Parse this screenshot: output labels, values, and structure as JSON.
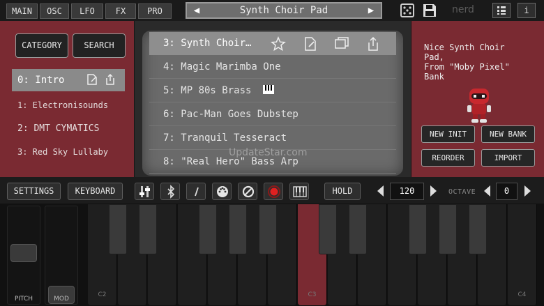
{
  "top_tabs": [
    "MAIN",
    "OSC",
    "LFO",
    "FX",
    "PRO"
  ],
  "preset": {
    "name": "Synth Choir Pad"
  },
  "brand": "nerd",
  "top_icons": [
    "dice-icon",
    "save-icon",
    "grid-icon",
    "info-icon"
  ],
  "info_label": "i",
  "left": {
    "category_label": "CATEGORY",
    "search_label": "SEARCH",
    "items": [
      "0: Intro",
      "1: Electronisounds",
      "2: DMT CYMATICS",
      "3: Red Sky Lullaby"
    ]
  },
  "presets": [
    "3: Synth Choir…",
    "4: Magic Marimba One",
    "5: MP 80s Brass",
    "6: Pac-Man Goes Dubstep",
    "7: Tranquil Tesseract",
    "8: \"Real Hero\" Bass Arp"
  ],
  "watermark": "UpdateStar.com",
  "right": {
    "description": [
      "Nice Synth Choir",
      "Pad,",
      "From \"Moby Pixel\"",
      "Bank"
    ],
    "buttons": [
      "NEW INIT",
      "NEW BANK",
      "REORDER",
      "IMPORT"
    ]
  },
  "controls": {
    "settings_label": "SETTINGS",
    "keyboard_label": "KEYBOARD",
    "hold_label": "HOLD",
    "tempo": "120",
    "octave_label": "OCTAVE",
    "octave": "0"
  },
  "keyboard": {
    "pitch_label": "PITCH",
    "mod_label": "MOD",
    "key_labels": [
      "C2",
      "C3",
      "C4"
    ]
  },
  "colors": {
    "panel_red": "#7a2a32",
    "screen_gray": "#6a6a6a"
  }
}
